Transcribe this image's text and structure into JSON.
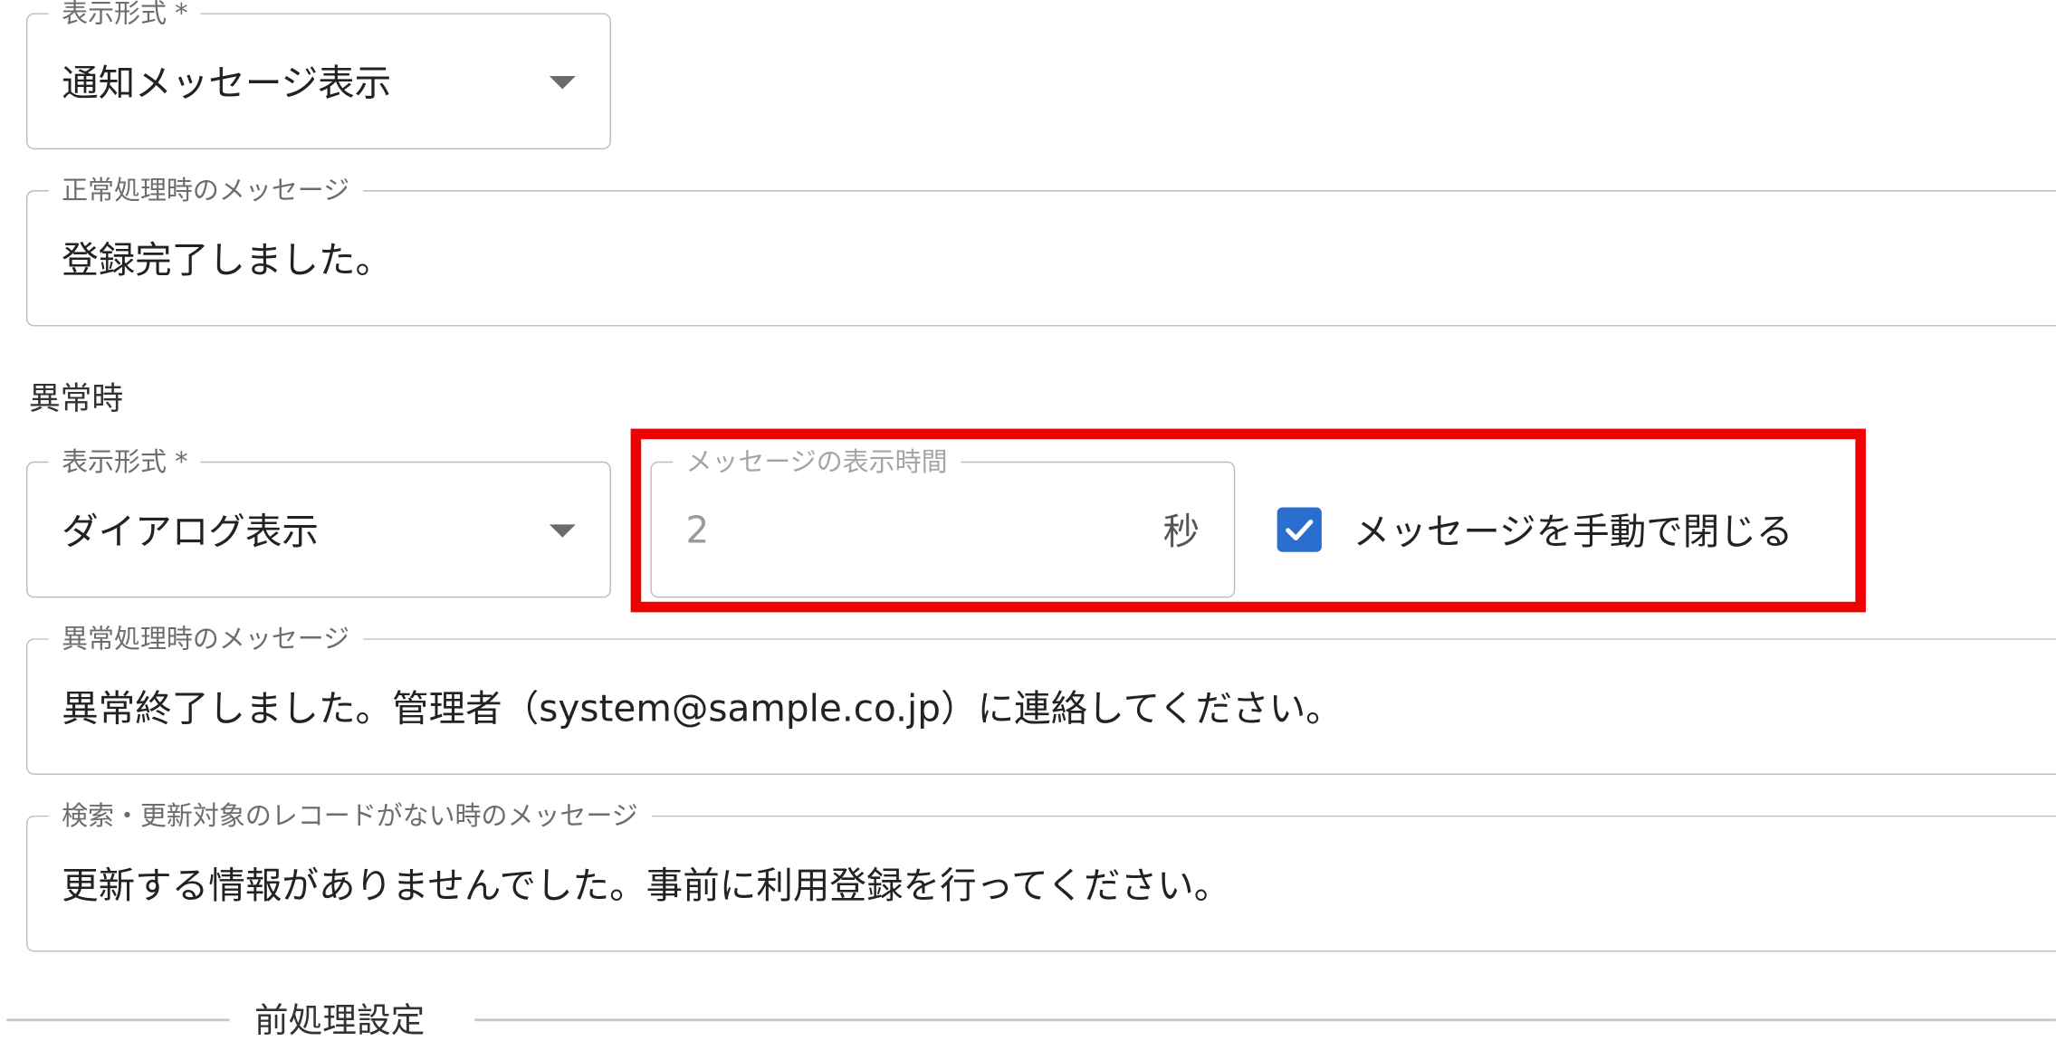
{
  "normal": {
    "display_format": {
      "label": "表示形式 *",
      "value": "通知メッセージ表示"
    },
    "message": {
      "label": "正常処理時のメッセージ",
      "value": "登録完了しました。"
    }
  },
  "error_section": {
    "heading": "異常時",
    "display_format": {
      "label": "表示形式 *",
      "value": "ダイアログ表示"
    },
    "display_time": {
      "label": "メッセージの表示時間",
      "value": "2",
      "unit": "秒"
    },
    "manual_close": {
      "label": "メッセージを手動で閉じる",
      "checked": true
    },
    "message": {
      "label": "異常処理時のメッセージ",
      "value": "異常終了しました。管理者（system@sample.co.jp）に連絡してください。"
    }
  },
  "no_record": {
    "label": "検索・更新対象のレコードがない時のメッセージ",
    "value": "更新する情報がありませんでした。事前に利用登録を行ってください。"
  },
  "preprocess": {
    "title": "前処理設定"
  },
  "colors": {
    "highlight": "#f00000",
    "checkbox": "#2a6fd0",
    "border": "#bdbdbd"
  },
  "icons": {
    "dropdown": "chevron-down-icon",
    "checkbox": "checkmark-icon"
  }
}
